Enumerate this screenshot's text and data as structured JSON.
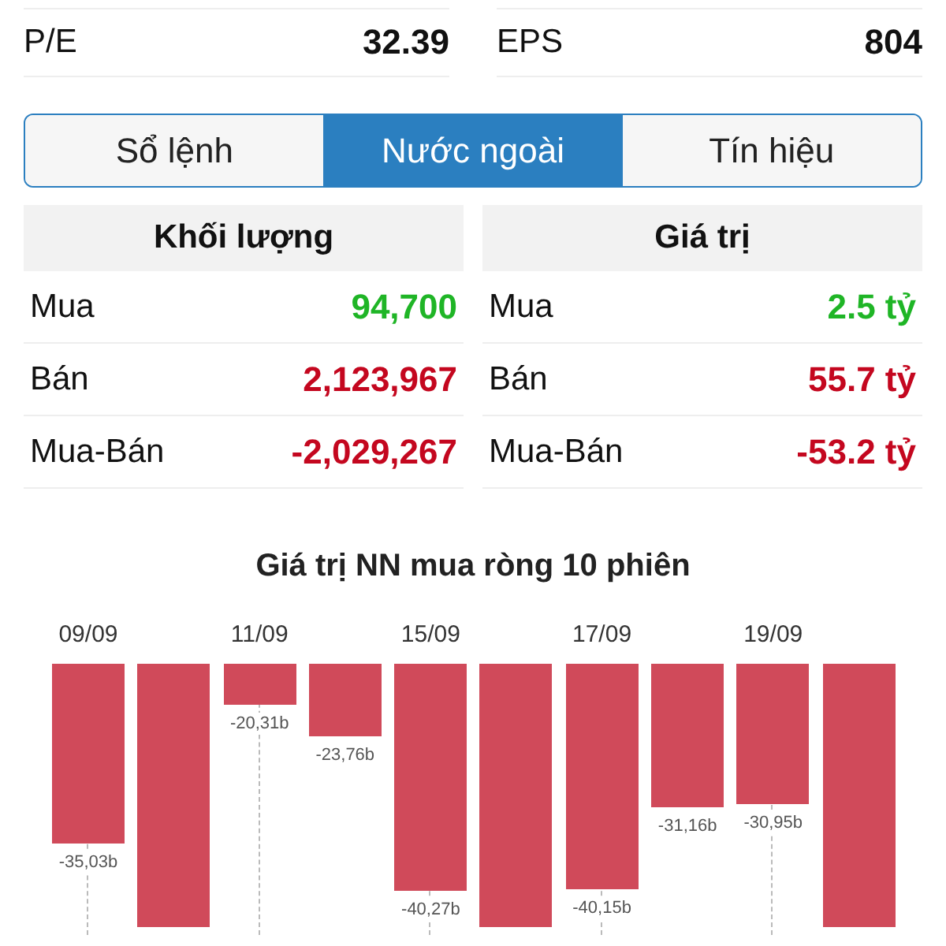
{
  "ratios": [
    {
      "label": "P/E",
      "value": "32.39"
    },
    {
      "label": "EPS",
      "value": "804"
    }
  ],
  "tabs": [
    {
      "label": "Sổ lệnh",
      "selected": false
    },
    {
      "label": "Nước ngoài",
      "selected": true
    },
    {
      "label": "Tín hiệu",
      "selected": false
    }
  ],
  "foreign_tables": [
    {
      "header": "Khối lượng",
      "rows": [
        {
          "label": "Mua",
          "value": "94,700",
          "color": "#1fb526"
        },
        {
          "label": "Bán",
          "value": "2,123,967",
          "color": "#c4071f"
        },
        {
          "label": "Mua-Bán",
          "value": "-2,029,267",
          "color": "#c4071f"
        }
      ]
    },
    {
      "header": "Giá trị",
      "rows": [
        {
          "label": "Mua",
          "value": "2.5 tỷ",
          "color": "#1fb526"
        },
        {
          "label": "Bán",
          "value": "55.7 tỷ",
          "color": "#c4071f"
        },
        {
          "label": "Mua-Bán",
          "value": "-53.2 tỷ",
          "color": "#c4071f"
        }
      ]
    }
  ],
  "chart": {
    "title": "Giá trị NN mua ròng 10 phiên",
    "date_labels": [
      "09/09",
      "11/09",
      "15/09",
      "17/09",
      "19/09"
    ],
    "value_labels": [
      "-35,03b",
      "-20,31b",
      "-23,76b",
      "-40,27b",
      "-40,15b",
      "-31,16b",
      "-30,95b"
    ]
  }
}
